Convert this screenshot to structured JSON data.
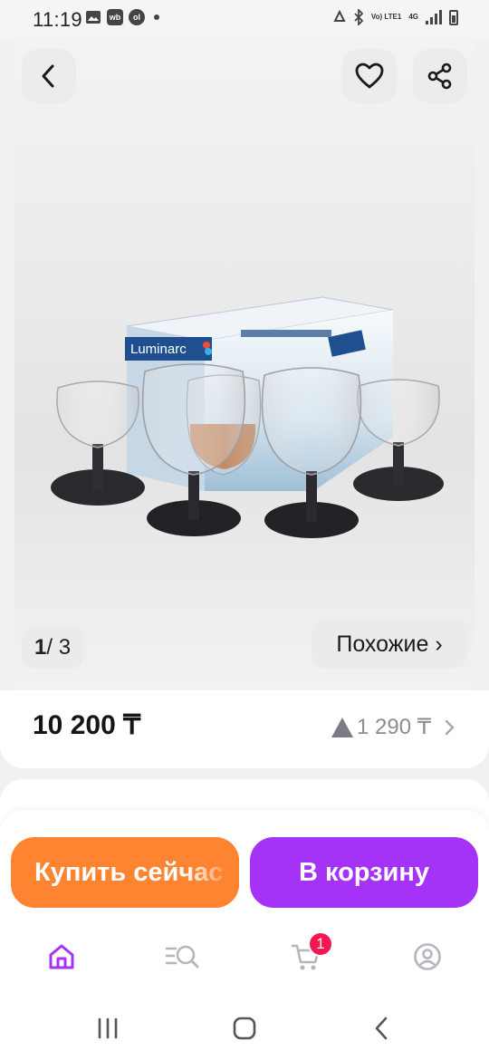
{
  "status_bar": {
    "time": "11:19",
    "left_icons": [
      "gallery-icon",
      "wb-icon",
      "olx-icon"
    ],
    "network": "Vo) LTE1",
    "network_type": "4G"
  },
  "image": {
    "brand_text": "Luminarc",
    "counter_current": "1",
    "counter_total": "/ 3",
    "similar_label": "Похожие ›"
  },
  "product": {
    "price": "10 200 ₸",
    "bonus": "1 290 ₸"
  },
  "actions": {
    "buy_now": "Купить сейчас",
    "add_to_cart": "В корзину"
  },
  "bottom_nav": {
    "items": [
      "home-icon",
      "catalog-search-icon",
      "cart-icon",
      "profile-icon"
    ],
    "cart_badge": "1",
    "active_color": "#a533f7"
  },
  "colors": {
    "buy_now": "#ff8432",
    "add_to_cart": "#a533f7",
    "badge": "#f5174f"
  }
}
